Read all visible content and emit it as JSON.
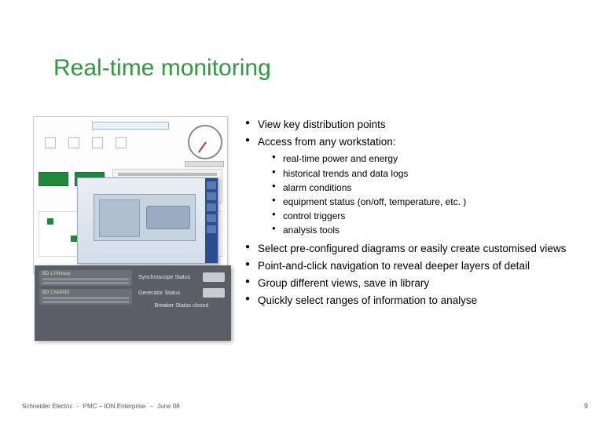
{
  "title": "Real-time monitoring",
  "bullets": {
    "b1": "View key distribution points",
    "b2": "Access from any workstation:",
    "sub": {
      "s1": "real-time power and energy",
      "s2": "historical trends and data logs",
      "s3": "alarm conditions",
      "s4": "equipment status (on/off, temperature, etc. )",
      "s5": "control triggers",
      "s6": "analysis tools"
    },
    "b3": "Select pre-configured diagrams or easily create customised views",
    "b4": "Point-and-click navigation to reveal deeper layers of detail",
    "b5": "Group different views, save in library",
    "b6": "Quickly select ranges of information to analyse"
  },
  "graphic": {
    "panel_labels": {
      "p1": "BD 1 Primary",
      "p2": "BD 2 MAINS",
      "r1": "Synchroscope Status",
      "r2": "Generator Status",
      "status": "Breaker Status closed"
    }
  },
  "footer": {
    "company": "Schneider Electric",
    "product": "PMC – ION Enterprise",
    "date": "June 08"
  },
  "page_number": "9"
}
